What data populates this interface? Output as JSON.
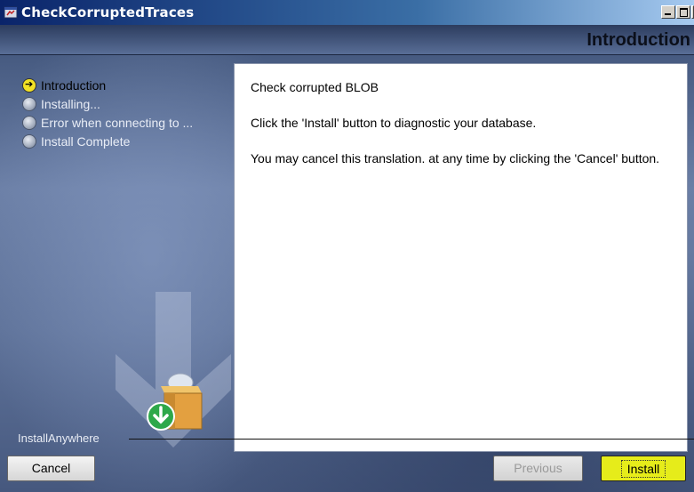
{
  "window": {
    "title": "CheckCorruptedTraces",
    "controls": [
      "minimize",
      "maximize",
      "close"
    ]
  },
  "header": {
    "page_title": "Introduction"
  },
  "steps": [
    {
      "label": "Introduction",
      "state": "current",
      "icon": "arrow-right-icon"
    },
    {
      "label": "Installing...",
      "state": "pending",
      "icon": "circle-icon"
    },
    {
      "label": "Error when connecting to ...",
      "state": "pending",
      "icon": "circle-icon"
    },
    {
      "label": "Install Complete",
      "state": "pending",
      "icon": "circle-icon"
    }
  ],
  "content": {
    "line1": "Check corrupted BLOB",
    "line2": "Click the 'Install' button to diagnostic your database.",
    "line3": "You may cancel this translation. at any time by clicking the 'Cancel' button."
  },
  "footer": {
    "brand": "InstallAnywhere",
    "cancel_label": "Cancel",
    "previous_label": "Previous",
    "install_label": "Install"
  },
  "colors": {
    "accent_install": "#e6ec1a",
    "active_step": "#f3e225",
    "title_bar": "#0a246a"
  }
}
